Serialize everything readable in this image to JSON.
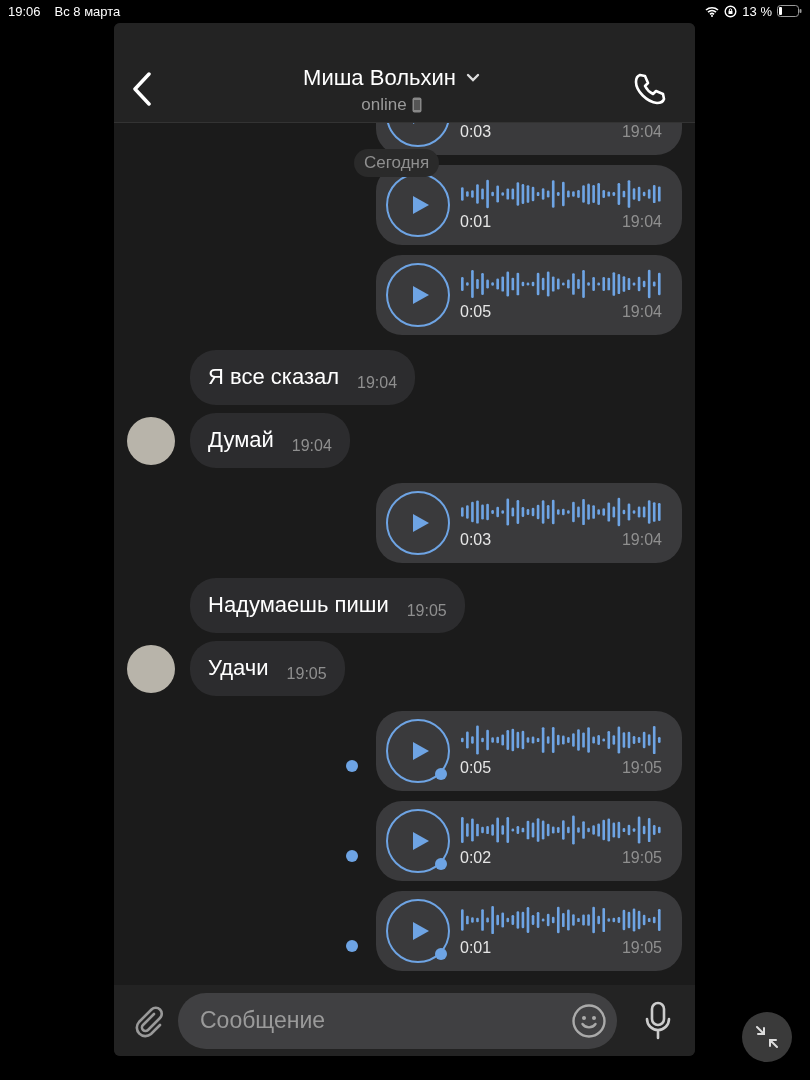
{
  "status_bar": {
    "time": "19:06",
    "date": "Вс 8 марта",
    "battery": "13 %"
  },
  "header": {
    "title": "Миша Вольхин",
    "status": "online"
  },
  "date_divider": "Сегодня",
  "messages": [
    {
      "kind": "voice",
      "outgoing": true,
      "duration": "0:03",
      "time": "19:04",
      "unread": false
    },
    {
      "kind": "voice",
      "outgoing": true,
      "duration": "0:01",
      "time": "19:04",
      "unread": false
    },
    {
      "kind": "voice",
      "outgoing": true,
      "duration": "0:05",
      "time": "19:04",
      "unread": false
    },
    {
      "kind": "text",
      "outgoing": false,
      "text": "Я все сказал",
      "time": "19:04",
      "avatar": false
    },
    {
      "kind": "text",
      "outgoing": false,
      "text": "Думай",
      "time": "19:04",
      "avatar": true
    },
    {
      "kind": "voice",
      "outgoing": true,
      "duration": "0:03",
      "time": "19:04",
      "unread": false
    },
    {
      "kind": "text",
      "outgoing": false,
      "text": "Надумаешь пиши",
      "time": "19:05",
      "avatar": false
    },
    {
      "kind": "text",
      "outgoing": false,
      "text": "Удачи",
      "time": "19:05",
      "avatar": true
    },
    {
      "kind": "voice",
      "outgoing": true,
      "duration": "0:05",
      "time": "19:05",
      "unread": true
    },
    {
      "kind": "voice",
      "outgoing": true,
      "duration": "0:02",
      "time": "19:05",
      "unread": true
    },
    {
      "kind": "voice",
      "outgoing": true,
      "duration": "0:01",
      "time": "19:05",
      "unread": true
    }
  ],
  "composer": {
    "placeholder": "Сообщение"
  }
}
